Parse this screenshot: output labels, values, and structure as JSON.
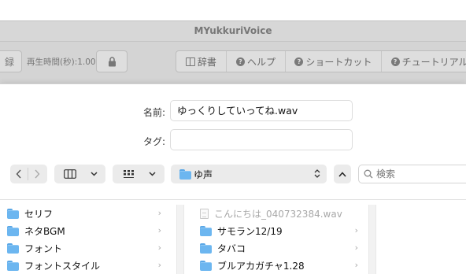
{
  "app": {
    "title": "MYukkuriVoice",
    "toolbar": {
      "record_label": "録",
      "playback_time_label": "再生時間(秒):1.00",
      "lock_icon": "lock-icon",
      "buttons": [
        {
          "label": "辞書",
          "icon": "book-icon"
        },
        {
          "label": "ヘルプ",
          "icon": "question-icon"
        },
        {
          "label": "ショートカット",
          "icon": "question-icon"
        },
        {
          "label": "チュートリアル",
          "icon": "question-icon"
        }
      ]
    }
  },
  "dialog": {
    "name_label": "名前:",
    "name_value": "ゆっくりしていってね.wav",
    "tag_label": "タグ:",
    "tag_value": "",
    "nav": {
      "back_icon": "chevron-left-icon",
      "forward_icon": "chevron-right-icon",
      "view_column_icon": "column-view-icon",
      "view_grid_icon": "grid-view-icon",
      "current_folder": "ゆ声",
      "up_icon": "chevron-up-icon",
      "search_placeholder": "検索"
    },
    "column1": [
      {
        "name": "セリフ",
        "type": "folder"
      },
      {
        "name": "ネタBGM",
        "type": "folder"
      },
      {
        "name": "フォント",
        "type": "folder"
      },
      {
        "name": "フォントスタイル",
        "type": "folder"
      }
    ],
    "column2": [
      {
        "name": "こんにちは_040732384.wav",
        "type": "file"
      },
      {
        "name": "サモラン12/19",
        "type": "folder"
      },
      {
        "name": "タバコ",
        "type": "folder"
      },
      {
        "name": "ブルアカガチャ1.28",
        "type": "folder"
      }
    ]
  },
  "colors": {
    "folder": "#6cb6f0",
    "toolbar_bg": "#d4d4d4",
    "disabled_text": "#a8a8a8"
  }
}
